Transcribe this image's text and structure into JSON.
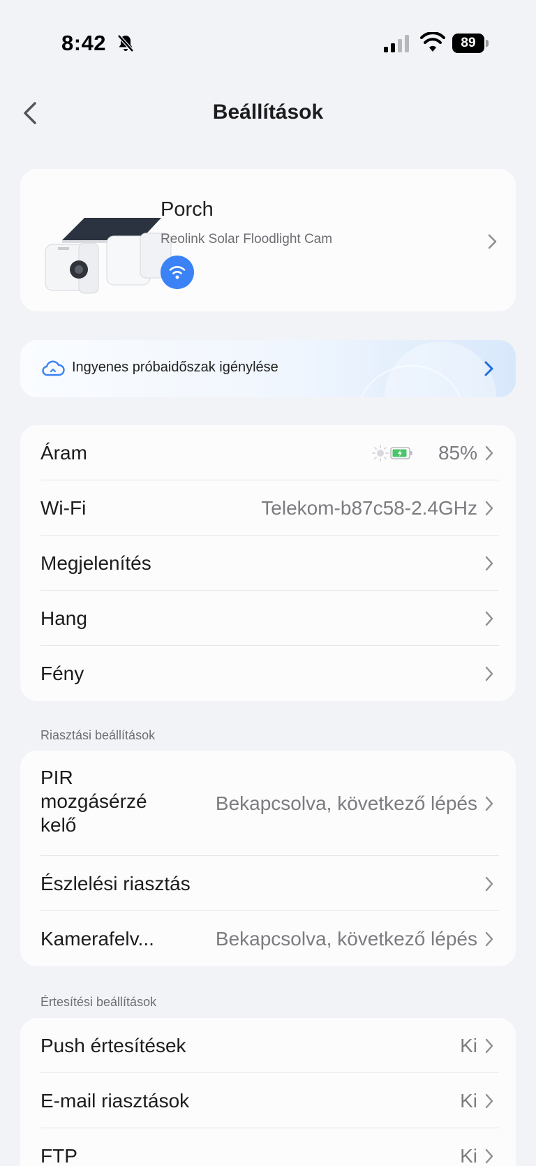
{
  "status_bar": {
    "time": "8:42",
    "battery": "89"
  },
  "nav": {
    "title": "Beállítások"
  },
  "device": {
    "name": "Porch",
    "model": "Reolink Solar Floodlight Cam"
  },
  "trial": {
    "text": "Ingyenes próbaidőszak igénylése"
  },
  "main_list": [
    {
      "label": "Áram",
      "value": "85%"
    },
    {
      "label": "Wi-Fi",
      "value": "Telekom-b87c58-2.4GHz"
    },
    {
      "label": "Megjelenítés",
      "value": ""
    },
    {
      "label": "Hang",
      "value": ""
    },
    {
      "label": "Fény",
      "value": ""
    }
  ],
  "alarm_section": {
    "title": "Riasztási beállítások",
    "rows": [
      {
        "label": "PIR mozgásérzé kelő",
        "value": "Bekapcsolva, következő lépés"
      },
      {
        "label": "Észlelési riasztás",
        "value": ""
      },
      {
        "label": "Kamerafelv...",
        "value": "Bekapcsolva, következő lépés"
      }
    ]
  },
  "notify_section": {
    "title": "Értesítési beállítások",
    "rows": [
      {
        "label": "Push értesítések",
        "value": "Ki"
      },
      {
        "label": "E-mail riasztások",
        "value": "Ki"
      },
      {
        "label": "FTP",
        "value": "Ki"
      }
    ]
  },
  "colors": {
    "accent": "#3a82f6",
    "background": "#f2f3f7",
    "card": "#fcfcfd"
  },
  "icons": [
    "bell-slash-icon",
    "signal-icon",
    "wifi-icon",
    "battery-icon",
    "back-icon",
    "cloud-icon",
    "chevron-right-icon",
    "sun-icon",
    "solar-battery-icon"
  ]
}
